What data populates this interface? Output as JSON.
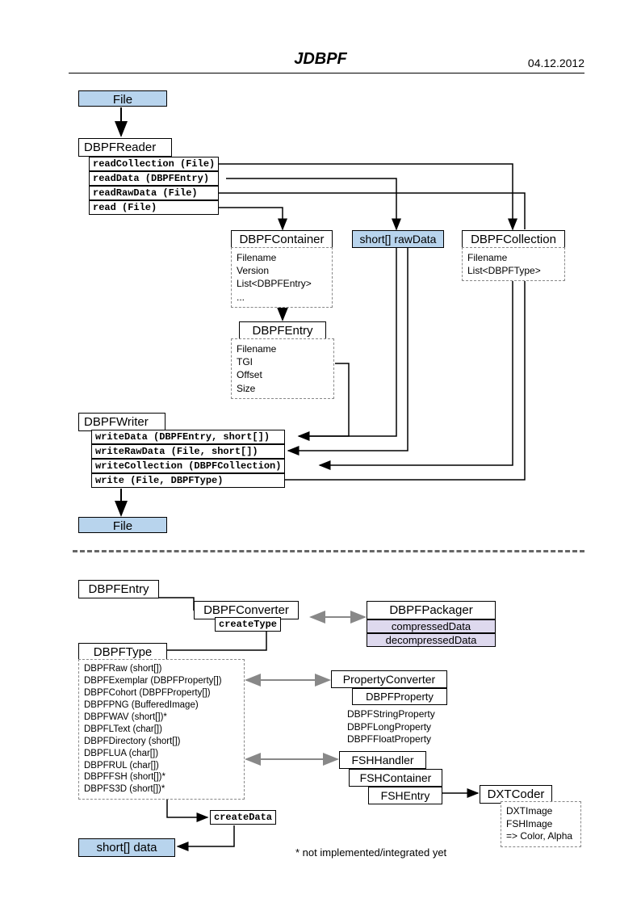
{
  "header": {
    "title": "JDBPF",
    "date": "04.12.2012"
  },
  "file_label": "File",
  "reader": {
    "name": "DBPFReader",
    "methods": {
      "m0": "readCollection (File)",
      "m1": "readData (DBPFEntry)",
      "m2": "readRawData (File)",
      "m3": "read (File)"
    }
  },
  "container": {
    "name": "DBPFContainer",
    "attrs": "Filename\nVersion\nList<DBPFEntry>\n..."
  },
  "rawdata": "short[] rawData",
  "collection": {
    "name": "DBPFCollection",
    "attrs": "Filename\nList<DBPFType>"
  },
  "entry": {
    "name": "DBPFEntry",
    "attrs": "Filename\nTGI\nOffset\nSize"
  },
  "writer": {
    "name": "DBPFWriter",
    "methods": {
      "m0": "writeData (DBPFEntry, short[])",
      "m1": "writeRawData (File, short[])",
      "m2": "writeCollection (DBPFCollection)",
      "m3": "write (File, DBPFType)"
    }
  },
  "lower": {
    "entry": "DBPFEntry",
    "converter": "DBPFConverter",
    "createType": "createType",
    "packager": "DBPFPackager",
    "compressed": "compressedData",
    "decompressed": "decompressedData",
    "dbpftype": "DBPFType",
    "types": "DBPFRaw (short[])\nDBPFExemplar (DBPFProperty[])\nDBPFCohort (DBPFProperty[])\nDBPFPNG (BufferedImage)\nDBPFWAV (short[])*\nDBPFLText (char[])\nDBPFDirectory (short[])\nDBPFLUA (char[])\nDBPFRUL (char[])\nDBPFFSH (short[])*\nDBPFS3D (short[])*",
    "propConverter": "PropertyConverter",
    "dbpfProperty": "DBPFProperty",
    "propSubs": "DBPFStringProperty\nDBPFLongProperty\nDBPFFloatProperty",
    "fshHandler": "FSHHandler",
    "fshContainer": "FSHContainer",
    "fshEntry": "FSHEntry",
    "dxtCoder": "DXTCoder",
    "dxtAttrs": "DXTImage\nFSHImage\n=> Color, Alpha",
    "createData": "createData",
    "shortData": "short[] data",
    "footnote": "* not implemented/integrated yet"
  }
}
